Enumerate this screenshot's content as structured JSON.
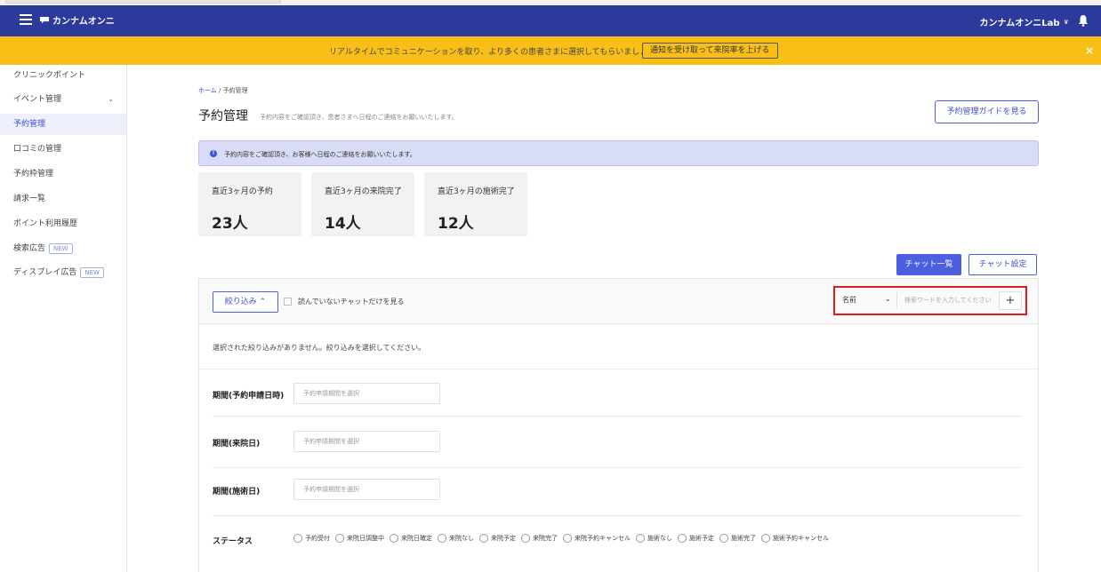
{
  "header": {
    "logo_text": "カンナムオンニ",
    "account_name": "カンナムオンニLab",
    "account_chevron": "∨"
  },
  "banner": {
    "message": "リアルタイムでコミュニケーションを取り、より多くの患者さまに選択してもらいましょう。",
    "cta_label": "通知を受け取って来院率を上げる",
    "close_label": "×",
    "color": "#f9bf17"
  },
  "sidebar": {
    "items": [
      {
        "label": "クリニックポイント"
      },
      {
        "label": "イベント管理",
        "caret": "⌄"
      },
      {
        "label": "予約管理",
        "active": true
      },
      {
        "label": "口コミの管理"
      },
      {
        "label": "予約枠管理"
      },
      {
        "label": "請求一覧"
      },
      {
        "label": "ポイント利用履歴"
      },
      {
        "label": "検索広告",
        "badge": "NEW"
      },
      {
        "label": "ディスプレイ広告",
        "badge": "NEW"
      }
    ]
  },
  "main": {
    "breadcrumb_home": "ホーム",
    "breadcrumb_sep": " / ",
    "breadcrumb_current": "予約管理",
    "title": "予約管理",
    "description": "予約内容をご確認頂き、患者さまへ日程のご連絡をお願いいたします。",
    "guide_button": "予約管理ガイドを見る",
    "info_icon": "!",
    "info_message": "予約内容をご確認頂き、お客様へ日程のご連絡をお願いいたします。",
    "stats": [
      {
        "label": "直近3ヶ月の予約",
        "value": "23人"
      },
      {
        "label": "直近3ヶ月の来院完了",
        "value": "14人"
      },
      {
        "label": "直近3ヶ月の施術完了",
        "value": "12人"
      }
    ],
    "chat_list_button": "チャット一覧",
    "chat_settings_button": "チャット設定"
  },
  "panel": {
    "filter_button": "絞り込み ⌃",
    "unread_label": "読んでいないチャットだけを見る",
    "search_field": "名前",
    "search_chevron": "⌄",
    "search_placeholder": "検索ワードを入力してください",
    "plus_label": "+",
    "no_filter_message": "選択された絞り込みがありません。絞り込みを選択してください。",
    "filters": [
      {
        "label": "期間(予約申請日時)",
        "placeholder": "予約申請期間を選択"
      },
      {
        "label": "期間(来院日)",
        "placeholder": "予約申請期間を選択"
      },
      {
        "label": "期間(施術日)",
        "placeholder": "予約申請期間を選択"
      }
    ],
    "status_label": "ステータス",
    "status_options": [
      "予約受付",
      "来院日調整中",
      "来院日確定",
      "来院なし",
      "来院予定",
      "来院完了",
      "来院予約キャンセル",
      "施術なし",
      "施術予定",
      "施術完了",
      "施術予約キャンセル"
    ]
  },
  "colors": {
    "topbar": "#2c3a9c",
    "accent": "#4b5fe0",
    "highlight_border": "#e01b22"
  }
}
